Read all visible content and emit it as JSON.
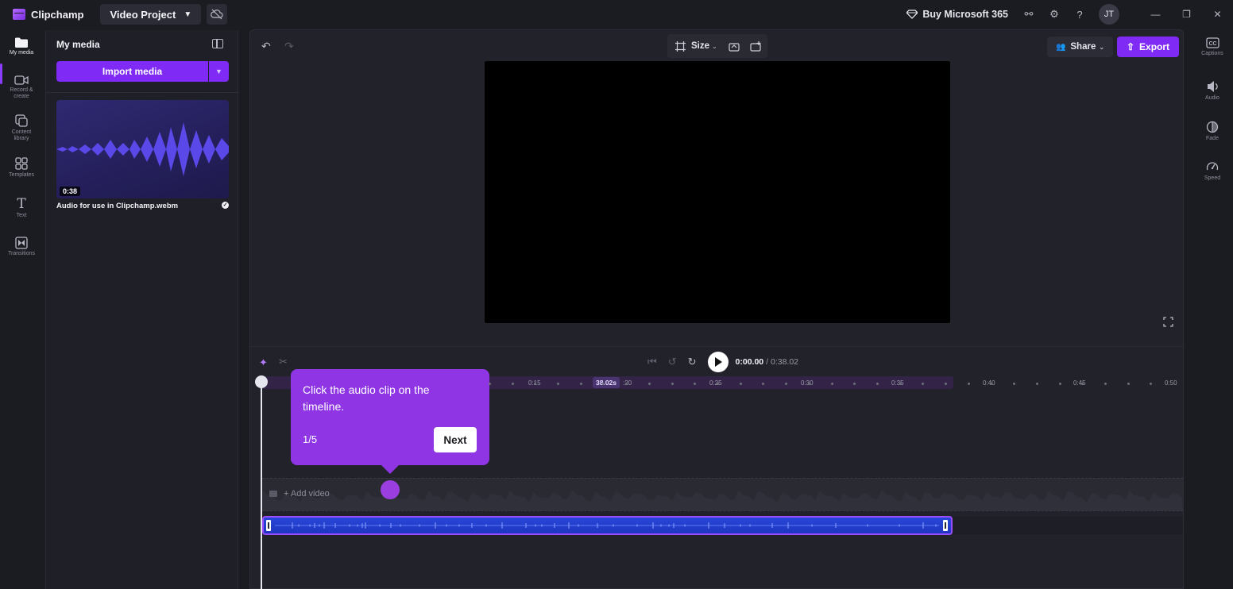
{
  "app": {
    "name": "Clipchamp",
    "project_name": "Video Project",
    "buy_label": "Buy Microsoft 365",
    "user_initials": "JT"
  },
  "left_rail": [
    {
      "label": "My media",
      "icon": "folder-icon",
      "active": true
    },
    {
      "label": "Record & create",
      "icon": "camera-icon"
    },
    {
      "label": "Content library",
      "icon": "library-icon"
    },
    {
      "label": "Templates",
      "icon": "templates-icon"
    },
    {
      "label": "Text",
      "icon": "text-icon"
    },
    {
      "label": "Transitions",
      "icon": "transitions-icon"
    }
  ],
  "media_panel": {
    "title": "My media",
    "import_label": "Import media",
    "item": {
      "name": "Audio for use in Clipchamp.webm",
      "duration": "0:38"
    }
  },
  "editor": {
    "size_label": "Size",
    "share_label": "Share",
    "export_label": "Export"
  },
  "timeline": {
    "time_current": "0:00.00",
    "time_total": "/ 0:38.02",
    "duration_pill": "38.02s",
    "ruler_labels": [
      "0:15",
      ":20",
      "0:25",
      "0:30",
      "0:35",
      "0:40",
      "0:45",
      "0:50"
    ],
    "add_video_label": "+ Add video"
  },
  "tooltip": {
    "text": "Click the audio clip on the timeline.",
    "step": "1/5",
    "next_label": "Next"
  },
  "right_rail": [
    {
      "label": "Captions",
      "icon": "captions-icon"
    },
    {
      "label": "Audio",
      "icon": "audio-icon"
    },
    {
      "label": "Fade",
      "icon": "fade-icon"
    },
    {
      "label": "Speed",
      "icon": "speed-icon"
    }
  ],
  "colors": {
    "accent": "#7f2bf5",
    "clip": "#2746d8",
    "tooltip": "#8f35e3"
  }
}
